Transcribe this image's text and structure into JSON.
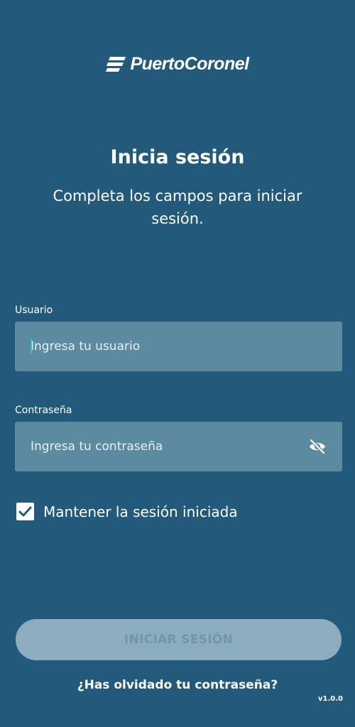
{
  "brand": {
    "logo_text": "PuertoCoronel",
    "logo_icon": "stacked-bars-logo-icon"
  },
  "header": {
    "title": "Inicia sesión",
    "subtitle": "Completa los campos para iniciar sesión."
  },
  "form": {
    "username": {
      "label": "Usuario",
      "placeholder": "Ingresa tu usuario",
      "value": ""
    },
    "password": {
      "label": "Contraseña",
      "placeholder": "Ingresa tu contraseña",
      "value": "",
      "visibility_icon": "eye-off-icon"
    },
    "remember": {
      "label": "Mantener la sesión iniciada",
      "checked": true,
      "icon": "check-icon"
    },
    "submit_label": "INICIAR SESIÓN",
    "submit_enabled": false
  },
  "footer": {
    "forgot_label": "¿Has olvidado tu contraseña?",
    "version": "v1.0.0"
  },
  "colors": {
    "background": "#235a7c",
    "input_background": "#5b8aa1",
    "button_disabled": "#8cacbf",
    "button_text_disabled": "#6e98b0",
    "caret": "#36c4b5"
  }
}
